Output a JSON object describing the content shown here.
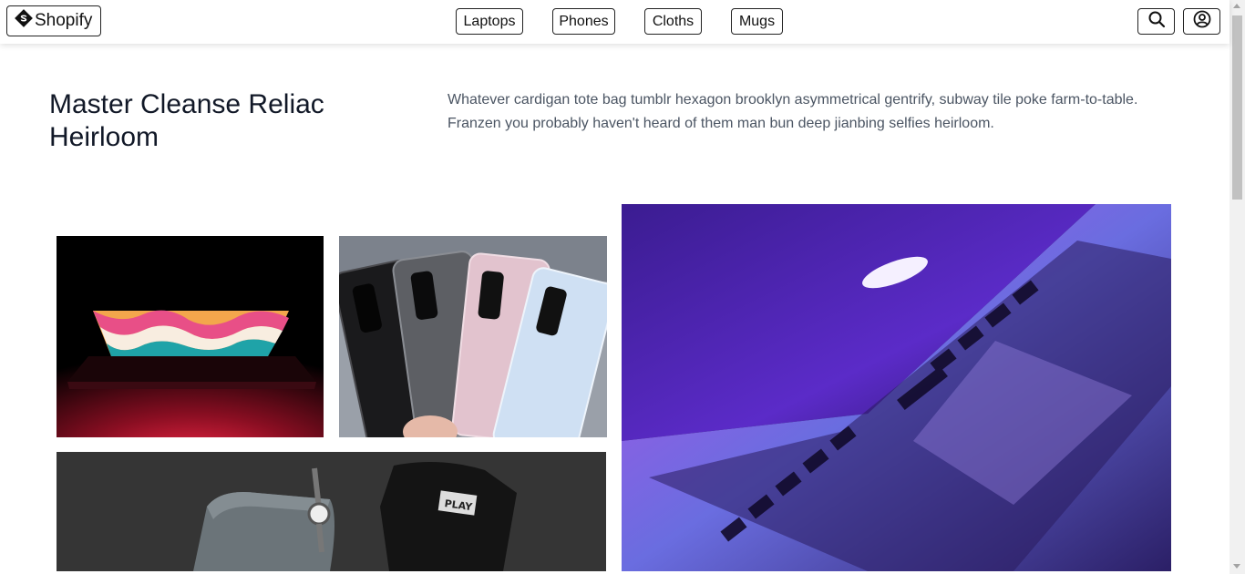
{
  "header": {
    "brand": "Shopify",
    "nav": [
      "Laptops",
      "Phones",
      "Cloths",
      "Mugs"
    ]
  },
  "hero": {
    "title": "Master Cleanse Reliac Heirloom",
    "description": "Whatever cardigan tote bag tumblr hexagon brooklyn asymmetrical gentrify, subway tile poke farm-to-table. Franzen you probably haven't heard of them man bun deep jianbing selfies heirloom."
  },
  "icons": {
    "brand": "shopify-logo-icon",
    "search": "search-icon",
    "account": "user-circle-icon"
  },
  "colors": {
    "title": "#111827",
    "description": "#4b5563",
    "border": "#222222"
  }
}
